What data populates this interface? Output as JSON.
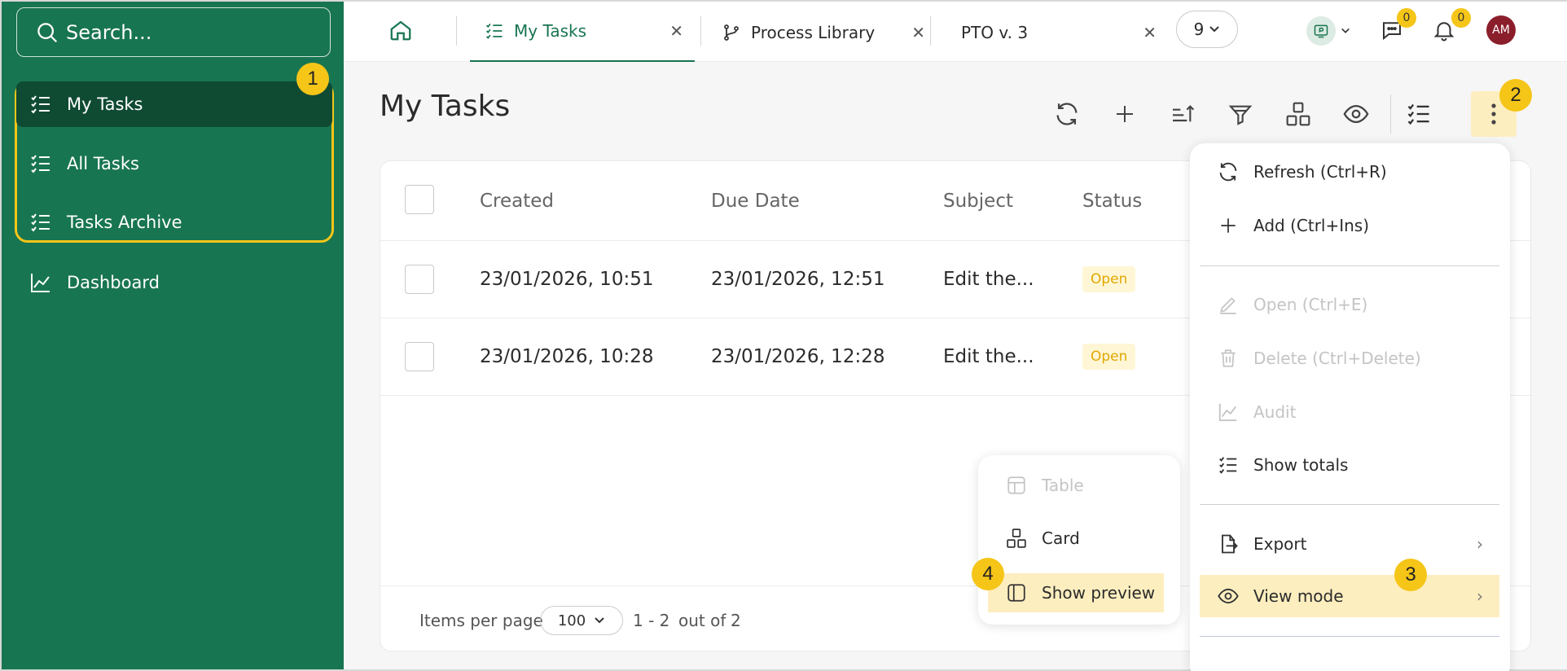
{
  "search": {
    "placeholder": "Search..."
  },
  "sidebar": {
    "items": [
      {
        "label": "My Tasks"
      },
      {
        "label": "All Tasks"
      },
      {
        "label": "Tasks Archive"
      },
      {
        "label": "Dashboard"
      }
    ]
  },
  "callouts": [
    "1",
    "2",
    "3",
    "4"
  ],
  "tabs": [
    {
      "label": "My Tasks"
    },
    {
      "label": "Process Library"
    },
    {
      "label": "PTO v. 3"
    }
  ],
  "topbar": {
    "tab_count": "9",
    "chat_badge": "0",
    "notif_badge": "0",
    "avatar_initials": "AM"
  },
  "page": {
    "title": "My Tasks"
  },
  "table": {
    "columns": [
      "Created",
      "Due Date",
      "Subject",
      "Status"
    ],
    "rows": [
      {
        "created": "23/01/2026, 10:51",
        "due": "23/01/2026, 12:51",
        "subject": "Edit the...",
        "status": "Open"
      },
      {
        "created": "23/01/2026, 10:28",
        "due": "23/01/2026, 12:28",
        "subject": "Edit the...",
        "status": "Open"
      }
    ],
    "footer": {
      "items_per_page_label": "Items per page",
      "per_page_value": "100",
      "range": "1 - 2",
      "out_of_label": "out of",
      "total": "2"
    }
  },
  "menu": {
    "items": [
      {
        "label": "Refresh (Ctrl+R)"
      },
      {
        "label": "Add (Ctrl+Ins)"
      },
      {
        "label": "Open (Ctrl+E)"
      },
      {
        "label": "Delete (Ctrl+Delete)"
      },
      {
        "label": "Audit"
      },
      {
        "label": "Show totals"
      },
      {
        "label": "Export"
      },
      {
        "label": "View mode"
      }
    ]
  },
  "submenu": {
    "items": [
      {
        "label": "Table"
      },
      {
        "label": "Card"
      },
      {
        "label": "Show preview"
      }
    ]
  },
  "colors": {
    "sidebar": "#187551",
    "accent": "#f5c518",
    "highlight": "#fdeebf",
    "status_open": "#e0a800"
  }
}
